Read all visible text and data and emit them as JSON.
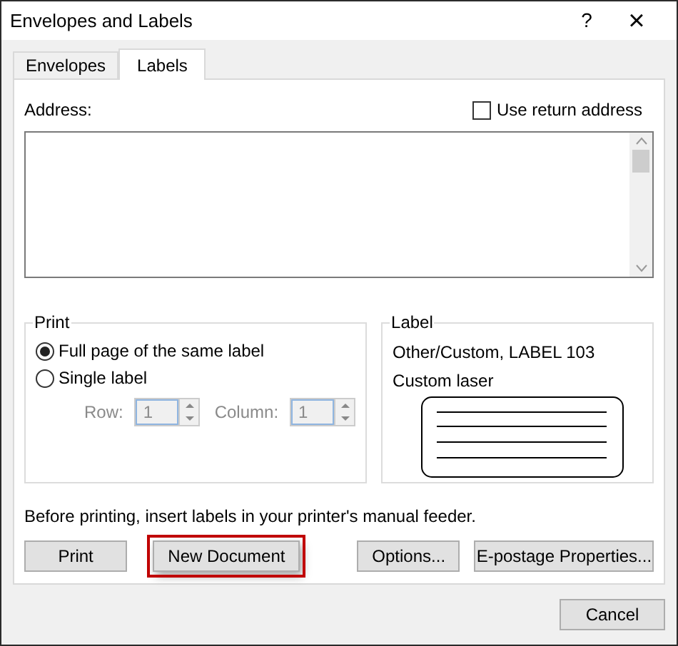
{
  "window": {
    "title": "Envelopes and Labels",
    "help": "?",
    "close": "×"
  },
  "tabs": [
    {
      "label": "Envelopes",
      "selected": false
    },
    {
      "label": "Labels",
      "selected": true
    }
  ],
  "address": {
    "label": "Address:",
    "use_return_address": {
      "label": "Use return address",
      "checked": false
    }
  },
  "print_group": {
    "title": "Print",
    "options": [
      {
        "label": "Full page of the same label",
        "selected": true
      },
      {
        "label": "Single label",
        "selected": false
      }
    ],
    "row": {
      "label": "Row:",
      "value": "1",
      "disabled": true
    },
    "column": {
      "label": "Column:",
      "value": "1",
      "disabled": true
    }
  },
  "label_group": {
    "title": "Label",
    "name": "Other/Custom, LABEL 103",
    "type": "Custom laser"
  },
  "note": "Before printing, insert labels in your printer's manual feeder.",
  "buttons": [
    {
      "label": "Print",
      "highlighted": false
    },
    {
      "label": "New Document",
      "highlighted": true
    },
    {
      "label": "Options...",
      "highlighted": false
    },
    {
      "label": "E-postage Properties...",
      "highlighted": false
    }
  ],
  "cancel": "Cancel"
}
